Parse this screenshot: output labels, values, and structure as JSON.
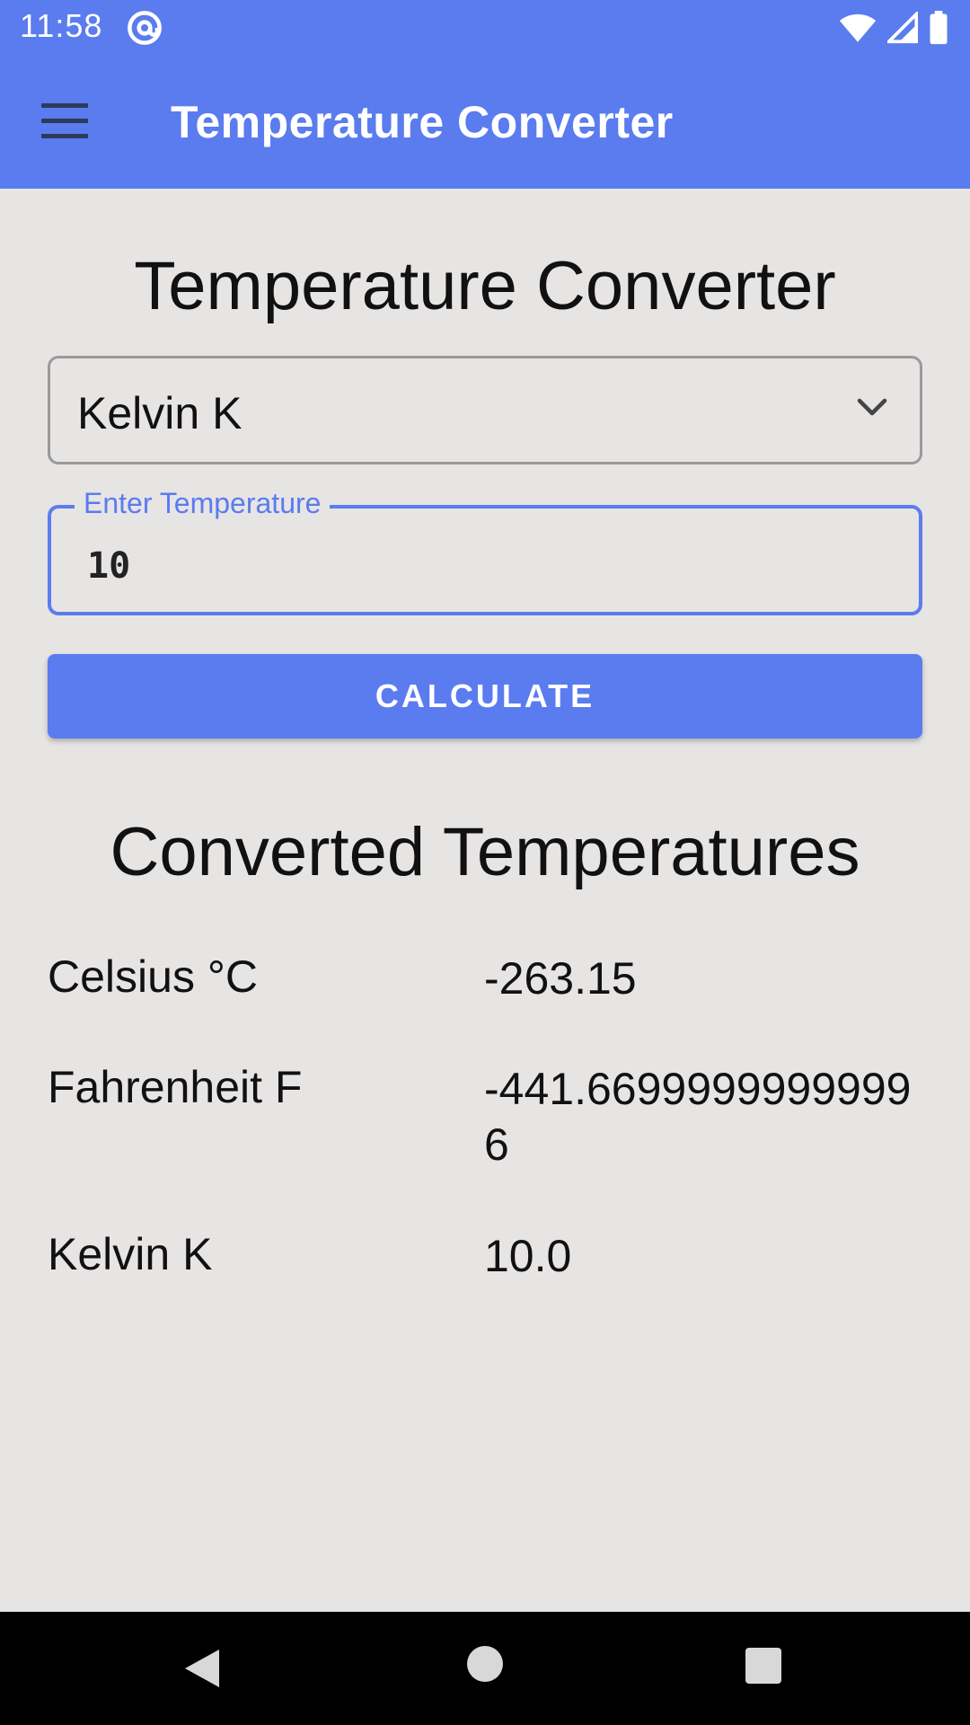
{
  "status_bar": {
    "time": "11:58",
    "icons": [
      "at-sign-icon",
      "wifi-icon",
      "signal-icon",
      "battery-icon"
    ]
  },
  "app_bar": {
    "title": "Temperature Converter",
    "menu_icon": "hamburger-menu-icon"
  },
  "main": {
    "title": "Temperature Converter",
    "unit_select": {
      "value": "Kelvin K",
      "icon": "chevron-down-icon"
    },
    "temperature_field": {
      "label": "Enter Temperature",
      "value": "10"
    },
    "calculate_label": "CALCULATE",
    "results_title": "Converted Temperatures",
    "results": [
      {
        "label": "Celsius °C",
        "value": "-263.15"
      },
      {
        "label": "Fahrenheit F",
        "value": "-441.66999999999996"
      },
      {
        "label": "Kelvin K",
        "value": "10.0"
      }
    ]
  },
  "nav_bar": {
    "icons": [
      "back-icon",
      "home-icon",
      "recents-icon"
    ]
  },
  "colors": {
    "primary": "#5a7cef",
    "background": "#e7e4e4",
    "text": "#111111",
    "nav_background": "#000000"
  }
}
